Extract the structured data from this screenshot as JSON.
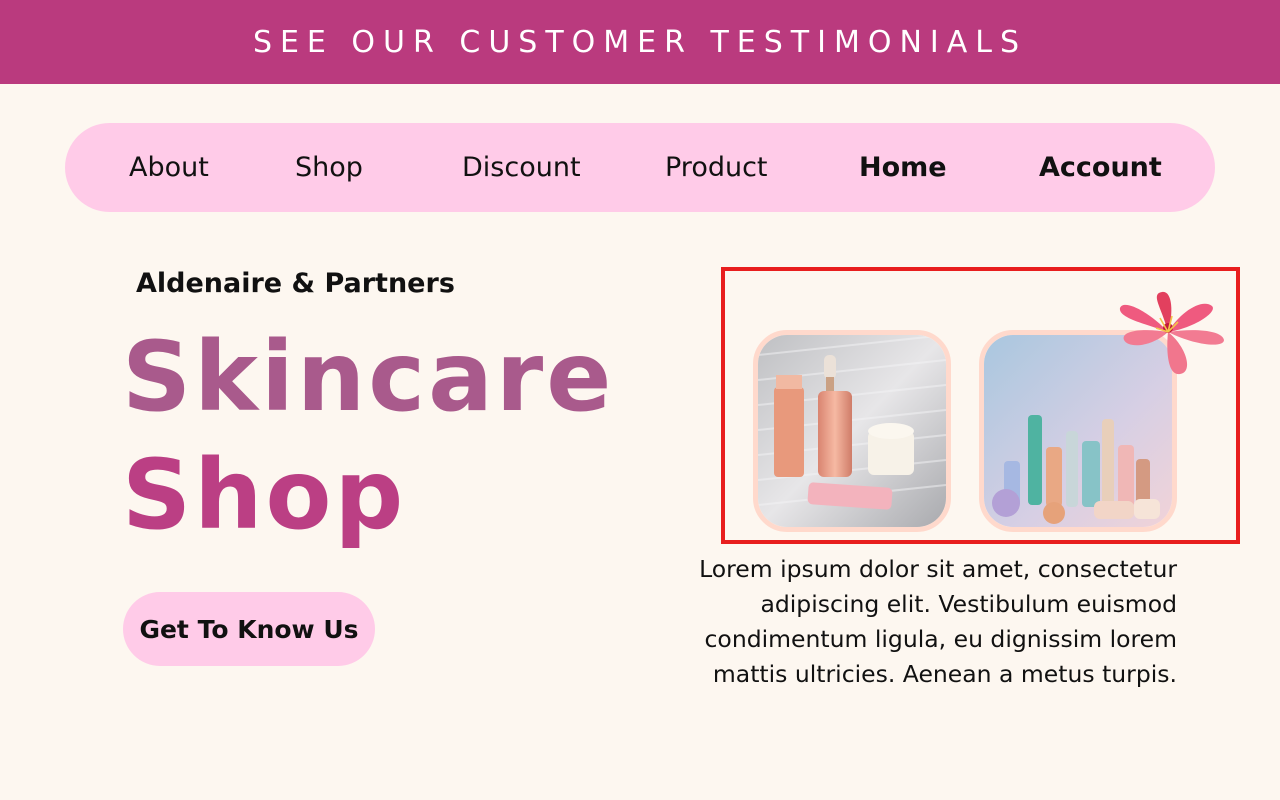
{
  "banner": {
    "text": "SEE OUR CUSTOMER TESTIMONIALS"
  },
  "nav": {
    "items": [
      {
        "label": "About"
      },
      {
        "label": "Shop"
      },
      {
        "label": "Discount"
      },
      {
        "label": "Product"
      },
      {
        "label": "Home"
      },
      {
        "label": "Account"
      }
    ]
  },
  "hero": {
    "subtitle": "Aldenaire & Partners",
    "title_line1": "Skincare",
    "title_line2": "Shop",
    "cta_label": "Get To Know Us"
  },
  "description": "Lorem ipsum dolor sit amet, consectetur adipiscing elit. Vestibulum euismod condimentum ligula, eu dignissim lorem mattis ultricies. Aenean a metus turpis.",
  "colors": {
    "background": "#fdf7f0",
    "banner": "#ba3a7e",
    "nav_pill": "#ffcbe8",
    "title_line1": "#a95a8c",
    "title_line2": "#bb3f84",
    "highlight_border": "#e81e1e",
    "flower": "#ef5a7f"
  }
}
